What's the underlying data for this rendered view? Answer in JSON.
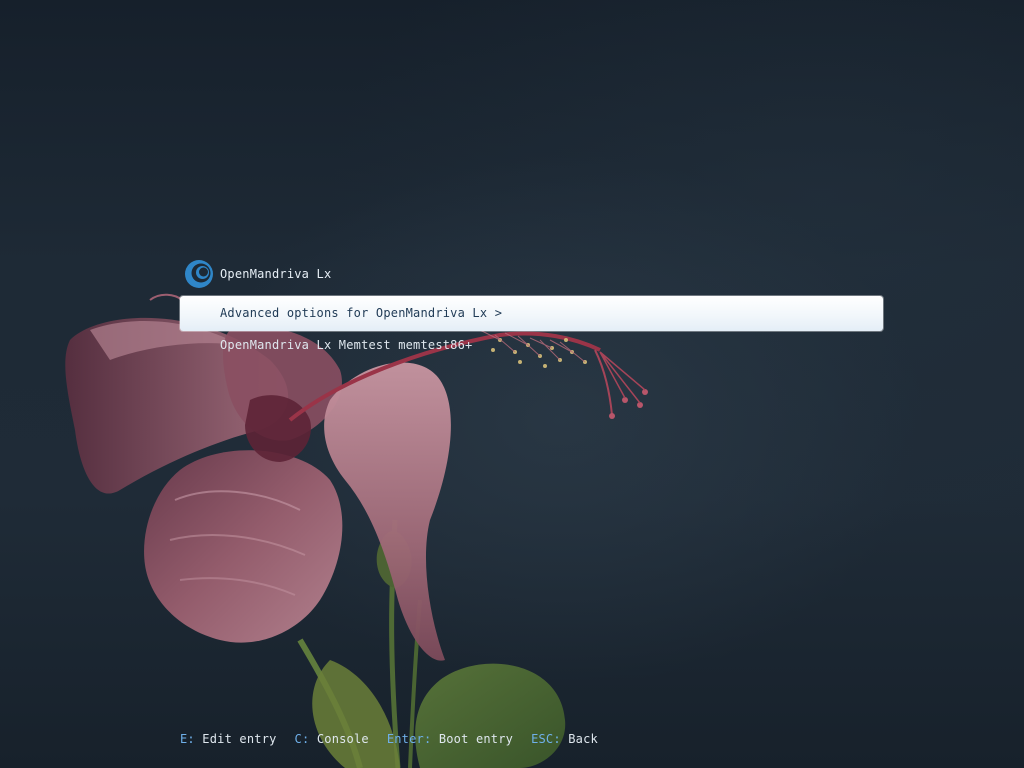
{
  "boot_menu": {
    "title": "OpenMandriva Lx",
    "logo_icon": "openmandriva-logo-icon",
    "entries": [
      {
        "label": "Advanced options for OpenMandriva Lx >",
        "selected": true
      },
      {
        "label": "OpenMandriva Lx Memtest memtest86+",
        "selected": false
      }
    ]
  },
  "footer": {
    "hints": [
      {
        "key": "E:",
        "action": "Edit entry"
      },
      {
        "key": "C:",
        "action": "Console"
      },
      {
        "key": "Enter:",
        "action": "Boot entry"
      },
      {
        "key": "ESC:",
        "action": "Back"
      }
    ]
  },
  "colors": {
    "background": "#1d2935",
    "selection": "#f2f7fb",
    "selection_text": "#1f3a55",
    "text": "#dfe7ee",
    "key_accent": "#6fb0ea",
    "logo_blue": "#2f86c8"
  }
}
